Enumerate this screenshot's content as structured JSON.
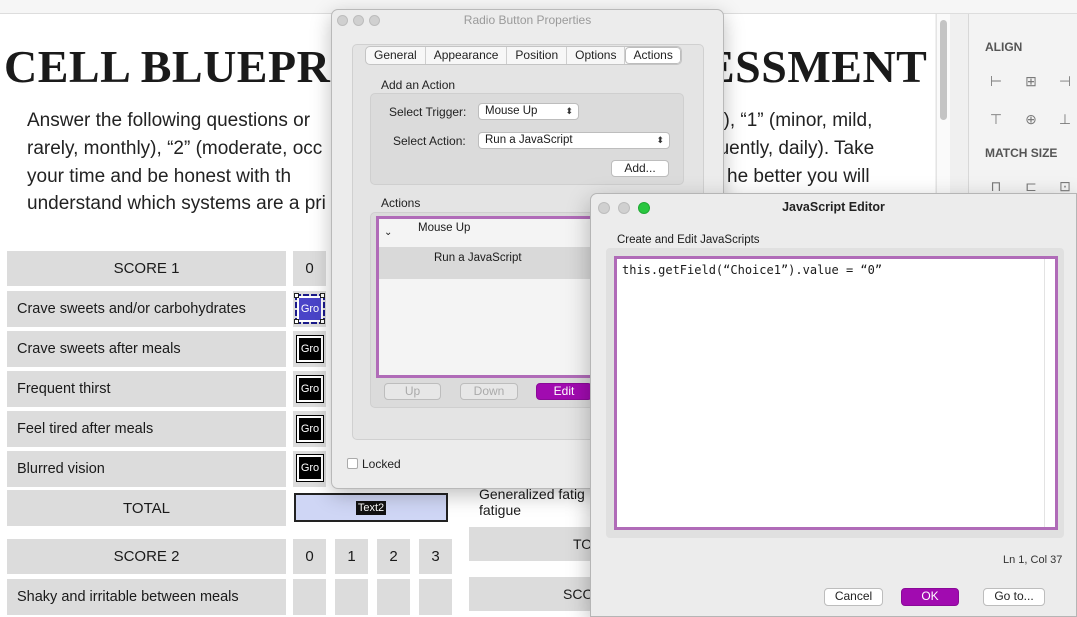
{
  "document": {
    "title_left": "CELL BLUEPRIN",
    "title_right": "ESSMENT",
    "intro_left": [
      "Answer the following questions or",
      "rarely, monthly), “2” (moderate, occ",
      "your time and be honest with th",
      "understand which systems are a pri"
    ],
    "intro_right": [
      "s), “1” (minor, mild,",
      "quently, daily). Take",
      "he better you will",
      ""
    ],
    "score1_header": "SCORE 1",
    "score1_col": "0",
    "rows1": [
      "Crave sweets and/or carbohydrates",
      "Crave sweets after meals",
      "Frequent thirst",
      "Feel tired after meals",
      "Blurred vision"
    ],
    "radio_label": "Gro",
    "total_label": "TOTAL",
    "total_field": "Text2",
    "score2_header": "SCORE 2",
    "score2_cols": [
      "0",
      "1",
      "2",
      "3"
    ],
    "rows2": [
      "Shaky and irritable between meals"
    ],
    "behind": {
      "generalized": "Generalized fatig",
      "fatigue": "fatigue",
      "to": "TO",
      "sco": "SCO"
    }
  },
  "right_panel": {
    "align_heading": "ALIGN",
    "match_heading": "MATCH SIZE",
    "icons": [
      "align-left-icon",
      "align-center-h-icon",
      "align-right-icon",
      "align-top-icon",
      "align-center-v-icon",
      "align-bottom-icon",
      "match-width-icon",
      "match-height-icon",
      "match-both-icon"
    ]
  },
  "props_dialog": {
    "title": "Radio Button Properties",
    "tabs": [
      "General",
      "Appearance",
      "Position",
      "Options",
      "Actions"
    ],
    "active_tab": "Actions",
    "add_action_label": "Add an Action",
    "trigger_label": "Select Trigger:",
    "trigger_value": "Mouse Up",
    "action_label": "Select Action:",
    "action_value": "Run a JavaScript",
    "add_button": "Add...",
    "actions_label": "Actions",
    "tree_trigger": "Mouse Up",
    "tree_action": "Run a JavaScript",
    "up_button": "Up",
    "down_button": "Down",
    "edit_button": "Edit",
    "locked_label": "Locked",
    "accent": "#a10bb0"
  },
  "js_editor": {
    "title": "JavaScript Editor",
    "subtitle": "Create and Edit JavaScripts",
    "code": "this.getField(“Choice1”).value = “0”",
    "cursor": "Ln 1, Col 37",
    "cancel": "Cancel",
    "ok": "OK",
    "goto": "Go to...",
    "highlight": "#b06bb8"
  }
}
